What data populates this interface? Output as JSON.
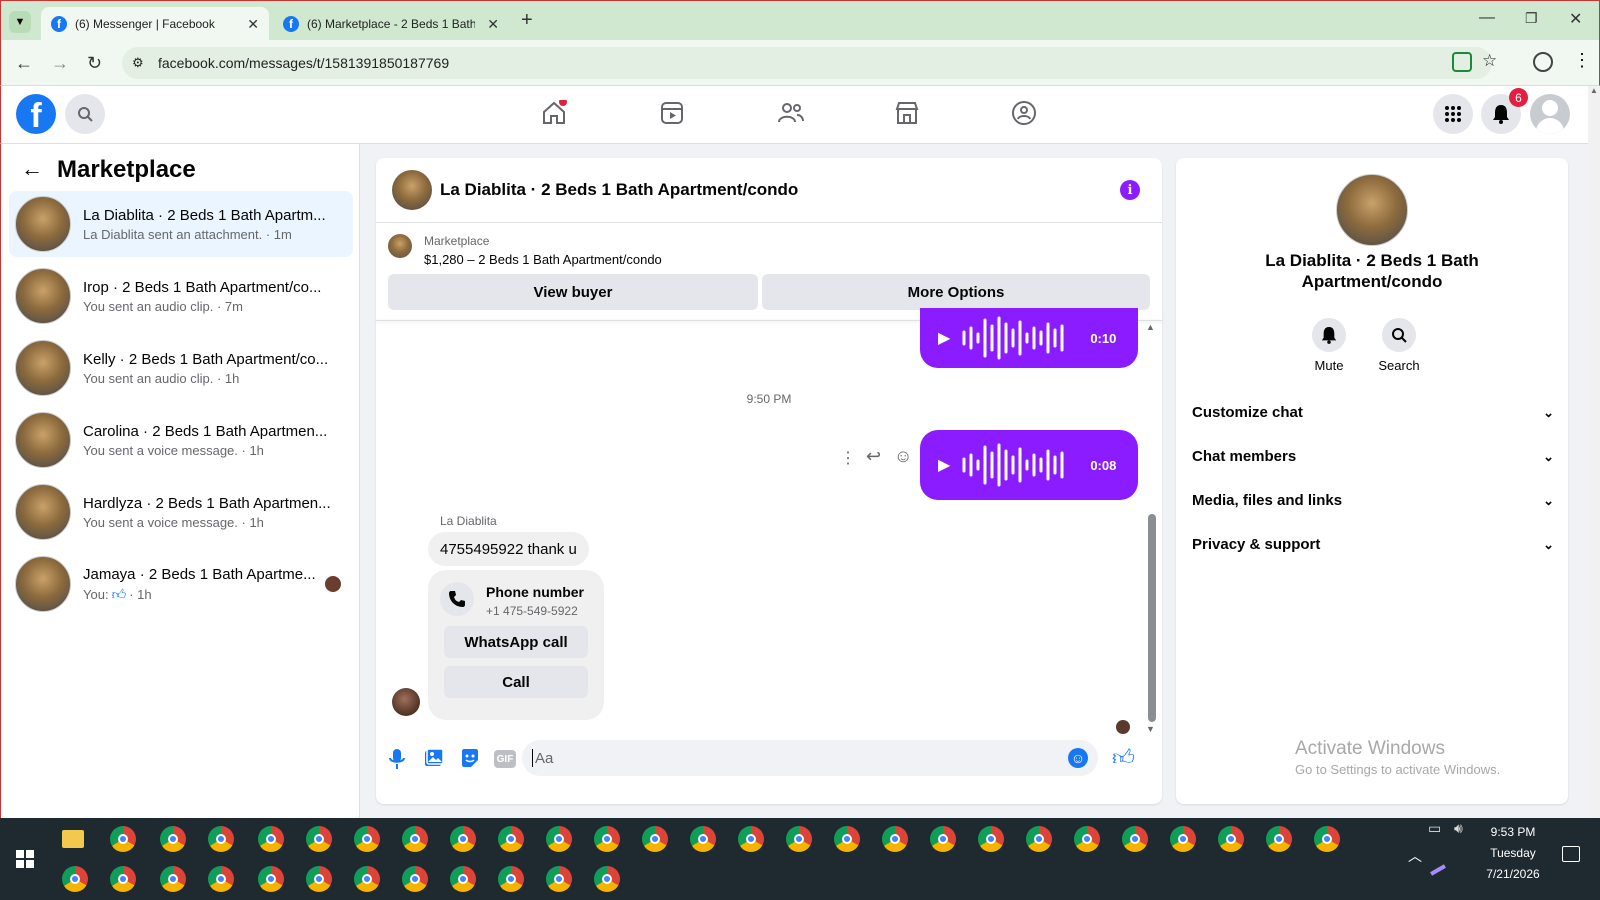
{
  "browser": {
    "tabs": [
      {
        "title": "(6) Messenger | Facebook"
      },
      {
        "title": "(6) Marketplace - 2 Beds 1 Bath"
      }
    ],
    "url": "facebook.com/messages/t/1581391850187769"
  },
  "header": {
    "notification_count": "6"
  },
  "left_panel": {
    "title": "Marketplace",
    "conversations": [
      {
        "name": "La Diablita · 2 Beds 1 Bath Apartm...",
        "preview": "La Diablita sent an attachment. · 1m"
      },
      {
        "name": "Irop · 2 Beds 1 Bath Apartment/co...",
        "preview": "You sent an audio clip. · 7m"
      },
      {
        "name": "Kelly · 2 Beds 1 Bath Apartment/co...",
        "preview": "You sent an audio clip. · 1h"
      },
      {
        "name": "Carolina · 2 Beds 1 Bath Apartmen...",
        "preview": "You sent a voice message. · 1h"
      },
      {
        "name": "Hardlyza · 2 Beds 1 Bath Apartmen...",
        "preview": "You sent a voice message. · 1h"
      },
      {
        "name": "Jamaya · 2 Beds 1 Bath Apartme...",
        "preview_you": "You:",
        "preview_time": "· 1h"
      }
    ]
  },
  "chat": {
    "title": "La Diablita · 2 Beds 1 Bath Apartment/condo",
    "listing_label": "Marketplace",
    "listing_price": "$1,280 – 2 Beds 1 Bath Apartment/condo",
    "view_buyer": "View buyer",
    "more_options": "More Options",
    "voice1_duration": "0:10",
    "timestamp": "9:50 PM",
    "voice2_duration": "0:08",
    "sender_name": "La Diablita",
    "incoming_text": "4755495922 thank u",
    "phone_card_title": "Phone number",
    "phone_card_number": "+1 475-549-5922",
    "whatsapp_call": "WhatsApp call",
    "call": "Call",
    "composer_placeholder": "Aa"
  },
  "right_panel": {
    "title": "La Diablita · 2 Beds 1 Bath Apartment/condo",
    "mute": "Mute",
    "search": "Search",
    "sections": [
      "Customize chat",
      "Chat members",
      "Media, files and links",
      "Privacy & support"
    ],
    "watermark_title": "Activate Windows",
    "watermark_sub": "Go to Settings to activate Windows."
  },
  "taskbar": {
    "time": "9:53 PM",
    "day": "Tuesday",
    "date": "7/21/2026"
  },
  "colors": {
    "fb_blue": "#1877f2",
    "messenger_purple": "#8a1cff",
    "selected_bg": "#ebf5ff"
  }
}
